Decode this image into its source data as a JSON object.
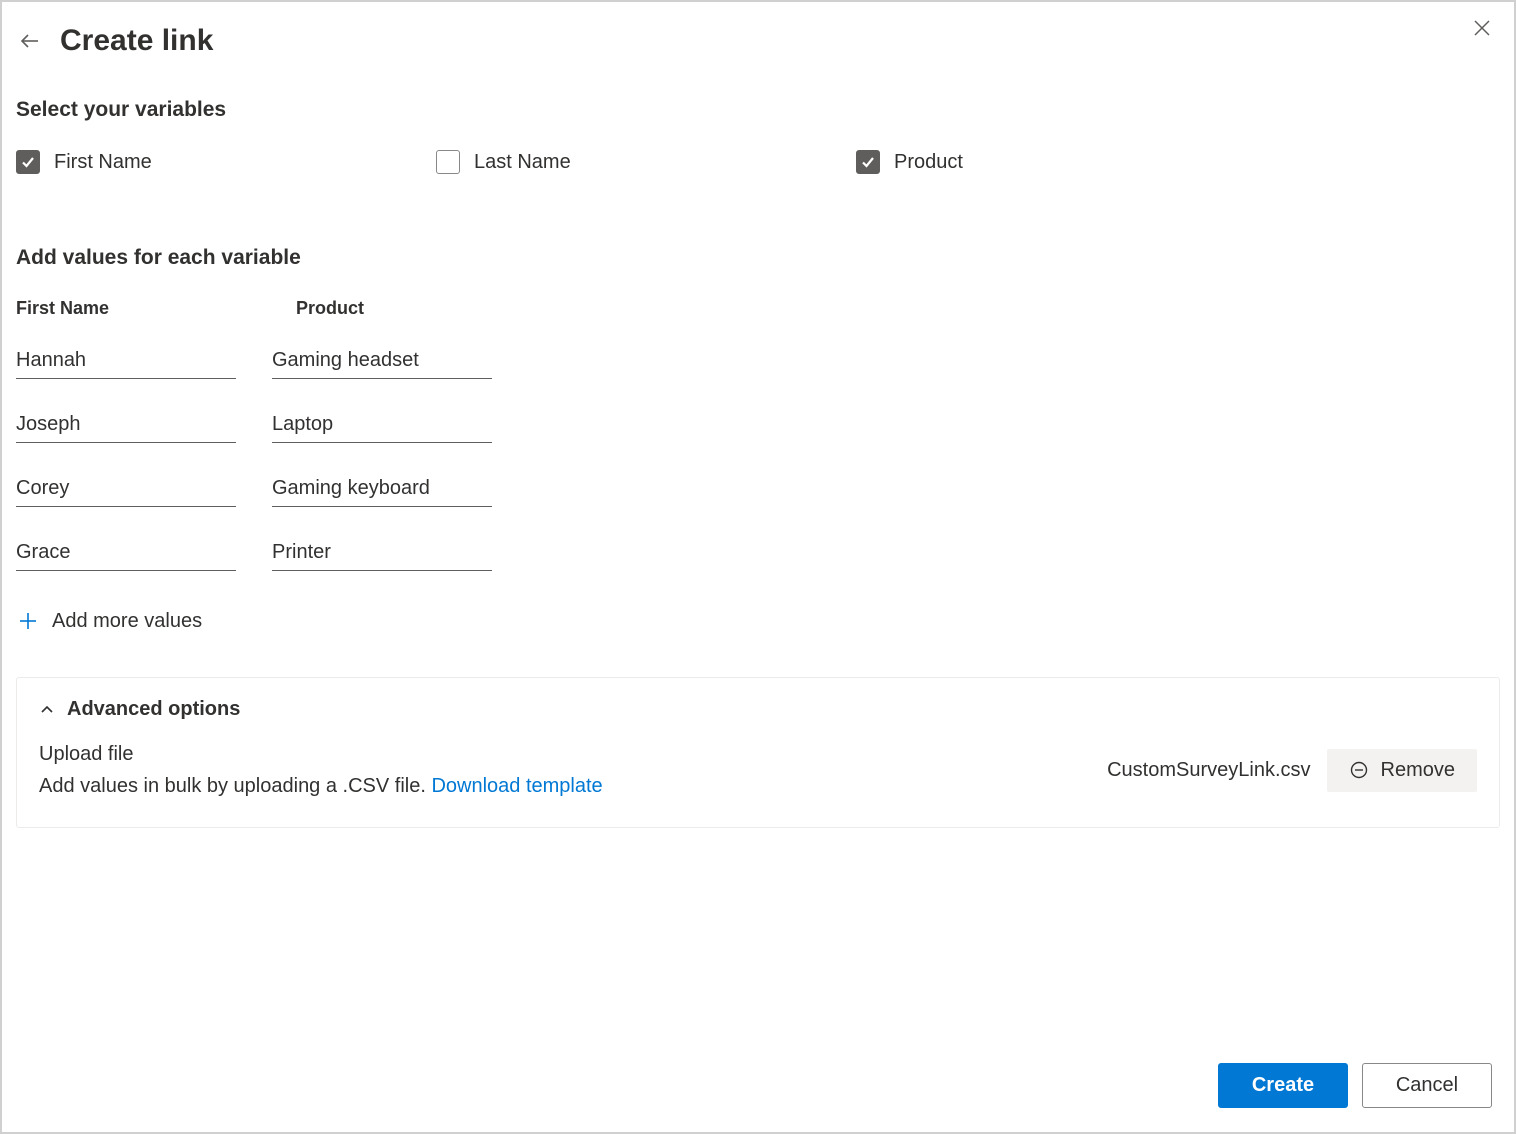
{
  "header": {
    "title": "Create link"
  },
  "variables": {
    "heading": "Select your variables",
    "options": [
      {
        "label": "First Name",
        "checked": true
      },
      {
        "label": "Last Name",
        "checked": false
      },
      {
        "label": "Product",
        "checked": true
      }
    ]
  },
  "values": {
    "heading": "Add values for each variable",
    "columns": [
      {
        "header": "First Name"
      },
      {
        "header": "Product"
      }
    ],
    "rows": [
      {
        "c0": "Hannah",
        "c1": "Gaming headset"
      },
      {
        "c0": "Joseph",
        "c1": "Laptop"
      },
      {
        "c0": "Corey",
        "c1": "Gaming keyboard"
      },
      {
        "c0": "Grace",
        "c1": "Printer"
      }
    ],
    "addMoreLabel": "Add more values"
  },
  "advanced": {
    "title": "Advanced options",
    "uploadTitle": "Upload file",
    "uploadHelp": "Add values in bulk by uploading a .CSV file. ",
    "downloadLabel": "Download template",
    "filename": "CustomSurveyLink.csv",
    "removeLabel": "Remove"
  },
  "footer": {
    "primary": "Create",
    "secondary": "Cancel"
  }
}
